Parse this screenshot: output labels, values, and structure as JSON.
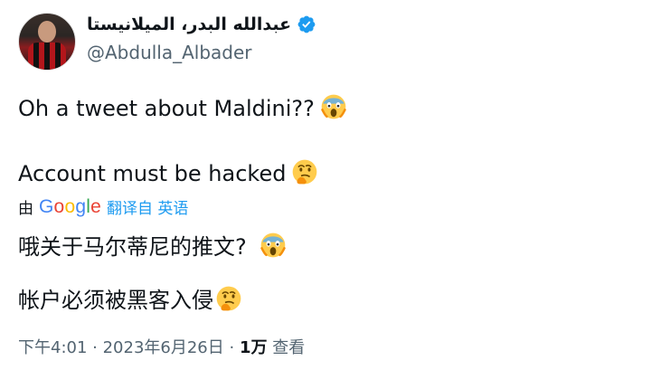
{
  "author": {
    "display_name": "عبدالله البدر، الميلانيستا",
    "handle": "@Abdulla_Albader",
    "verified": true
  },
  "tweet": {
    "line1": "Oh a tweet about Maldini??",
    "line2": "Account must be hacked",
    "translated_by_prefix": "由",
    "translated_by_brand": "Google",
    "translated_label": "翻译自 英语",
    "line3": "哦关于马尔蒂尼的推文?",
    "line4": "帐户必须被黑客入侵"
  },
  "icons": {
    "scream": "scream-emoji-icon",
    "thinking": "thinking-emoji-icon",
    "verified": "verified-badge-icon"
  },
  "meta": {
    "time": "下午4:01",
    "separator": " · ",
    "date": "2023年6月26日",
    "views_count": "1万",
    "views_label": "查看"
  },
  "colors": {
    "text": "#0f1419",
    "secondary": "#536471",
    "accent": "#1d9bf0"
  }
}
